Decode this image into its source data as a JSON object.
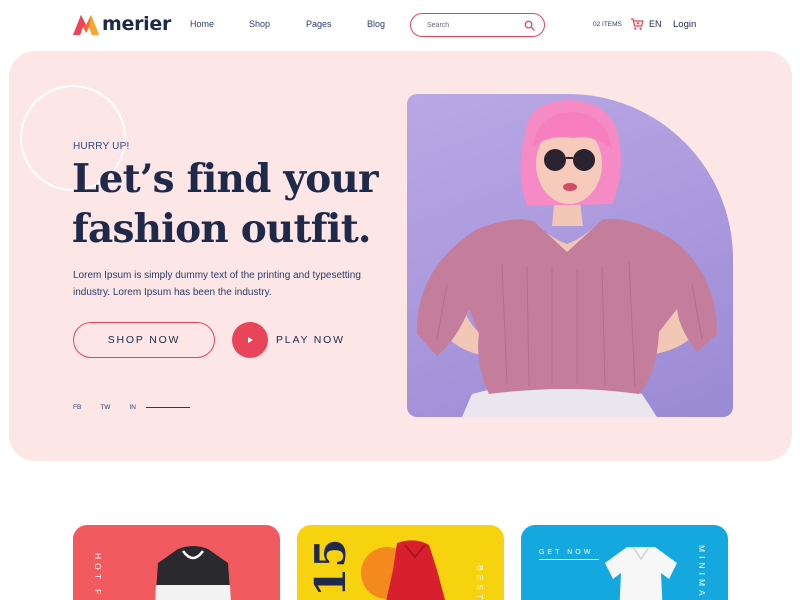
{
  "brand": {
    "name": "merier"
  },
  "nav": {
    "items": [
      "Home",
      "Shop",
      "Pages",
      "Blog"
    ]
  },
  "search": {
    "placeholder": "Search"
  },
  "cart": {
    "items_label": "02 ITEMS"
  },
  "language": "EN",
  "login": "Login",
  "hero": {
    "eyebrow": "HURRY UP!",
    "title_line1": "Let’s find your",
    "title_line2": "fashion outfit.",
    "description": "Lorem Ipsum is simply dummy text of the printing and typesetting industry. Lorem Ipsum has been the industry.",
    "shop_button": "SHOP NOW",
    "play_button": "PLAY NOW",
    "social": [
      "FB",
      "TW",
      "IN"
    ]
  },
  "cards": [
    {
      "vertical_label": "HOT F"
    },
    {
      "vertical_label": "BEST"
    },
    {
      "vertical_label": "MINIMA",
      "link": "GET NOW"
    }
  ],
  "colors": {
    "accent": "#e8455a",
    "text": "#1f2a4a",
    "hero_bg": "#fde6e6",
    "card_red": "#f15a5f",
    "card_yellow": "#f6d20f",
    "card_blue": "#14a8df"
  }
}
